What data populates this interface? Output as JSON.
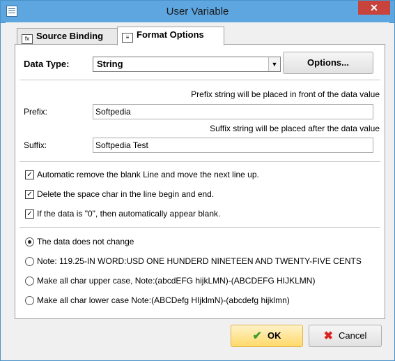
{
  "window": {
    "title": "User Variable",
    "close_symbol": "✕"
  },
  "tabs": [
    {
      "label": "Source Binding",
      "icon": "fx-icon"
    },
    {
      "label": "Format Options",
      "icon": "format-icon"
    }
  ],
  "data_type": {
    "label": "Data Type:",
    "selected": "String",
    "options_button": "Options..."
  },
  "prefix": {
    "hint": "Prefix string will be placed in front of the data value",
    "label": "Prefix:",
    "value": "Softpedia"
  },
  "suffix": {
    "hint": "Suffix string will be placed after the data value",
    "label": "Suffix:",
    "value": "Softpedia Test"
  },
  "checkboxes": [
    {
      "label": "Automatic remove the blank Line and move the next line up.",
      "checked": true
    },
    {
      "label": "Delete the space char in the line begin and end.",
      "checked": true
    },
    {
      "label": "If the data is \"0\", then automatically appear blank.",
      "checked": true
    }
  ],
  "radios": [
    {
      "label": "The data does not change",
      "selected": true
    },
    {
      "label": "Note: 119.25-IN WORD:USD ONE HUNDERD NINETEEN AND TWENTY-FIVE CENTS",
      "selected": false
    },
    {
      "label": "Make all char upper case, Note:(abcdEFG hijkLMN)-(ABCDEFG HIJKLMN)",
      "selected": false
    },
    {
      "label": "Make all char lower case Note:(ABCDefg HIjklmN)-(abcdefg hijklmn)",
      "selected": false
    }
  ],
  "footer": {
    "ok": "OK",
    "cancel": "Cancel"
  },
  "colors": {
    "titlebar": "#5ea6e0",
    "close": "#c7433b",
    "ok_button": "#ffd96a"
  }
}
